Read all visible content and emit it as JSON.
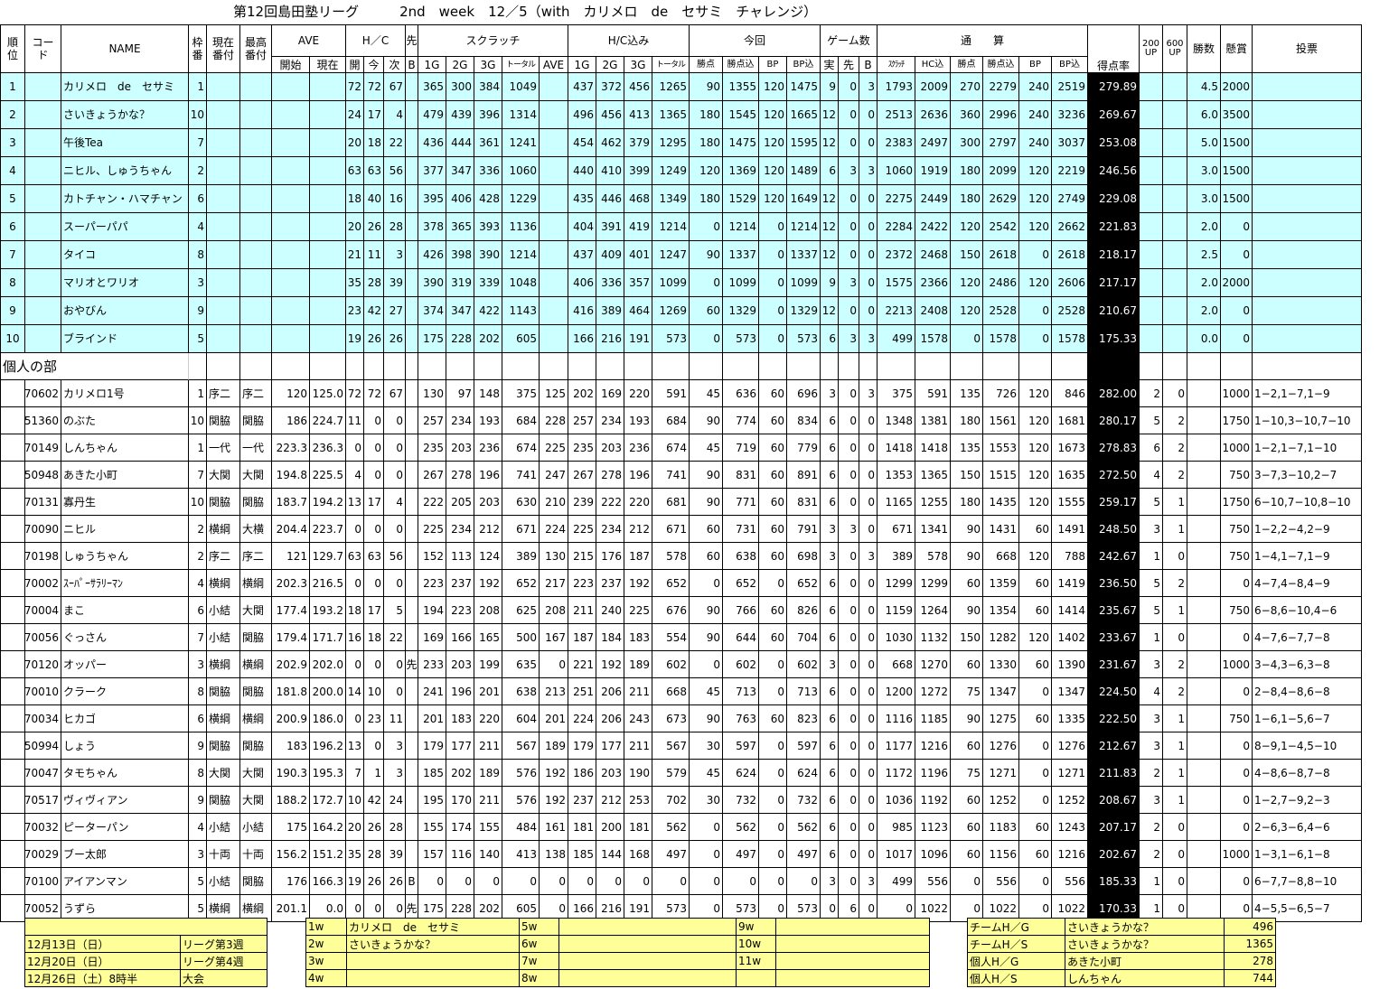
{
  "title": "第12回島田塾リーグ　　　2nd　week　12／5（with　カリメロ　de　セサミ　チャレンジ）",
  "headers": {
    "rank": "順位",
    "code": "コード",
    "name": "NAME",
    "waku": "枠番",
    "genzai": "現在番付",
    "saiko": "最高番付",
    "ave": "AVE",
    "hc": "H／C",
    "saki": "先",
    "scratch": "スクラッチ",
    "hcin": "H/C込み",
    "konkai": "今回",
    "games": "ゲーム数",
    "tsusan": "通　　算",
    "tokutenritsu": "得点率",
    "up200": "200 UP",
    "up600": "600 UP",
    "shosu": "勝数",
    "kensho": "懸賞",
    "tohyo": "投票",
    "kaishi": "開始",
    "genzai2": "現在",
    "kai": "開",
    "kon": "今",
    "ji": "次",
    "b": "B",
    "g1": "1G",
    "g2": "2G",
    "g3": "3G",
    "total": "トータル",
    "ave2": "AVE",
    "h1": "1G",
    "h2": "2G",
    "h3": "3G",
    "htotal": "トータル",
    "k_shoten": "勝点",
    "k_shoten_in": "勝点込",
    "k_bp": "BP",
    "k_bp_in": "BP込",
    "g_jitsu": "実",
    "g_saki": "先",
    "g_b": "B",
    "t_scratch": "ｽｸﾗｯﾁ",
    "t_hc": "HC込",
    "t_shoten": "勝点",
    "t_shoten_in": "勝点込",
    "t_bp": "BP",
    "t_bp_in": "BP込"
  },
  "section_individual": "個人の部",
  "teams": [
    [
      "1",
      "",
      "カリメロ　de　セサミ",
      "1",
      "",
      "",
      "",
      "",
      "72",
      "72",
      "67",
      "",
      "365",
      "300",
      "384",
      "1049",
      "",
      "437",
      "372",
      "456",
      "1265",
      "90",
      "1355",
      "120",
      "1475",
      "9",
      "0",
      "3",
      "1793",
      "2009",
      "270",
      "2279",
      "240",
      "2519",
      "279.89",
      "",
      "",
      "4.5",
      "2000",
      ""
    ],
    [
      "2",
      "",
      "さいきょうかな？",
      "10",
      "",
      "",
      "",
      "",
      "24",
      "17",
      "4",
      "",
      "479",
      "439",
      "396",
      "1314",
      "",
      "496",
      "456",
      "413",
      "1365",
      "180",
      "1545",
      "120",
      "1665",
      "12",
      "0",
      "0",
      "2513",
      "2636",
      "360",
      "2996",
      "240",
      "3236",
      "269.67",
      "",
      "",
      "6.0",
      "3500",
      ""
    ],
    [
      "3",
      "",
      "午後Tea",
      "7",
      "",
      "",
      "",
      "",
      "20",
      "18",
      "22",
      "",
      "436",
      "444",
      "361",
      "1241",
      "",
      "454",
      "462",
      "379",
      "1295",
      "180",
      "1475",
      "120",
      "1595",
      "12",
      "0",
      "0",
      "2383",
      "2497",
      "300",
      "2797",
      "240",
      "3037",
      "253.08",
      "",
      "",
      "5.0",
      "1500",
      ""
    ],
    [
      "4",
      "",
      "ニヒル、しゅうちゃん",
      "2",
      "",
      "",
      "",
      "",
      "63",
      "63",
      "56",
      "",
      "377",
      "347",
      "336",
      "1060",
      "",
      "440",
      "410",
      "399",
      "1249",
      "120",
      "1369",
      "120",
      "1489",
      "6",
      "3",
      "3",
      "1060",
      "1919",
      "180",
      "2099",
      "120",
      "2219",
      "246.56",
      "",
      "",
      "3.0",
      "1500",
      ""
    ],
    [
      "5",
      "",
      "カトチャン・ハマチャン",
      "6",
      "",
      "",
      "",
      "",
      "18",
      "40",
      "16",
      "",
      "395",
      "406",
      "428",
      "1229",
      "",
      "435",
      "446",
      "468",
      "1349",
      "180",
      "1529",
      "120",
      "1649",
      "12",
      "0",
      "0",
      "2275",
      "2449",
      "180",
      "2629",
      "120",
      "2749",
      "229.08",
      "",
      "",
      "3.0",
      "1500",
      ""
    ],
    [
      "6",
      "",
      "スーパーパパ",
      "4",
      "",
      "",
      "",
      "",
      "20",
      "26",
      "28",
      "",
      "378",
      "365",
      "393",
      "1136",
      "",
      "404",
      "391",
      "419",
      "1214",
      "0",
      "1214",
      "0",
      "1214",
      "12",
      "0",
      "0",
      "2284",
      "2422",
      "120",
      "2542",
      "120",
      "2662",
      "221.83",
      "",
      "",
      "2.0",
      "0",
      ""
    ],
    [
      "7",
      "",
      "タイコ",
      "8",
      "",
      "",
      "",
      "",
      "21",
      "11",
      "3",
      "",
      "426",
      "398",
      "390",
      "1214",
      "",
      "437",
      "409",
      "401",
      "1247",
      "90",
      "1337",
      "0",
      "1337",
      "12",
      "0",
      "0",
      "2372",
      "2468",
      "150",
      "2618",
      "0",
      "2618",
      "218.17",
      "",
      "",
      "2.5",
      "0",
      ""
    ],
    [
      "8",
      "",
      "マリオとワリオ",
      "3",
      "",
      "",
      "",
      "",
      "35",
      "28",
      "39",
      "",
      "390",
      "319",
      "339",
      "1048",
      "",
      "406",
      "336",
      "357",
      "1099",
      "0",
      "1099",
      "0",
      "1099",
      "9",
      "3",
      "0",
      "1575",
      "2366",
      "120",
      "2486",
      "120",
      "2606",
      "217.17",
      "",
      "",
      "2.0",
      "2000",
      ""
    ],
    [
      "9",
      "",
      "おやびん",
      "9",
      "",
      "",
      "",
      "",
      "23",
      "42",
      "27",
      "",
      "374",
      "347",
      "422",
      "1143",
      "",
      "416",
      "389",
      "464",
      "1269",
      "60",
      "1329",
      "0",
      "1329",
      "12",
      "0",
      "0",
      "2213",
      "2408",
      "120",
      "2528",
      "0",
      "2528",
      "210.67",
      "",
      "",
      "2.0",
      "0",
      ""
    ],
    [
      "10",
      "",
      "ブラインド",
      "5",
      "",
      "",
      "",
      "",
      "19",
      "26",
      "26",
      "",
      "175",
      "228",
      "202",
      "605",
      "",
      "166",
      "216",
      "191",
      "573",
      "0",
      "573",
      "0",
      "573",
      "6",
      "3",
      "3",
      "499",
      "1578",
      "0",
      "1578",
      "0",
      "1578",
      "175.33",
      "",
      "",
      "0.0",
      "0",
      ""
    ]
  ],
  "players": [
    [
      "",
      "70602",
      "カリメロ1号",
      "1",
      "序二",
      "序二",
      "120",
      "125.0",
      "72",
      "72",
      "67",
      "",
      "130",
      "97",
      "148",
      "375",
      "125",
      "202",
      "169",
      "220",
      "591",
      "45",
      "636",
      "60",
      "696",
      "3",
      "0",
      "3",
      "375",
      "591",
      "135",
      "726",
      "120",
      "846",
      "282.00",
      "2",
      "0",
      "",
      "1000",
      "1−2,1−7,1−9"
    ],
    [
      "",
      "51360",
      "のぶた",
      "10",
      "関脇",
      "関脇",
      "186",
      "224.7",
      "11",
      "0",
      "0",
      "",
      "257",
      "234",
      "193",
      "684",
      "228",
      "257",
      "234",
      "193",
      "684",
      "90",
      "774",
      "60",
      "834",
      "6",
      "0",
      "0",
      "1348",
      "1381",
      "180",
      "1561",
      "120",
      "1681",
      "280.17",
      "5",
      "2",
      "",
      "1750",
      "1−10,3−10,7−10"
    ],
    [
      "",
      "70149",
      "しんちゃん",
      "1",
      "一代",
      "一代",
      "223.3",
      "236.3",
      "0",
      "0",
      "0",
      "",
      "235",
      "203",
      "236",
      "674",
      "225",
      "235",
      "203",
      "236",
      "674",
      "45",
      "719",
      "60",
      "779",
      "6",
      "0",
      "0",
      "1418",
      "1418",
      "135",
      "1553",
      "120",
      "1673",
      "278.83",
      "6",
      "2",
      "",
      "1000",
      "1−2,1−7,1−10"
    ],
    [
      "",
      "50948",
      "あきた小町",
      "7",
      "大関",
      "大関",
      "194.8",
      "225.5",
      "4",
      "0",
      "0",
      "",
      "267",
      "278",
      "196",
      "741",
      "247",
      "267",
      "278",
      "196",
      "741",
      "90",
      "831",
      "60",
      "891",
      "6",
      "0",
      "0",
      "1353",
      "1365",
      "150",
      "1515",
      "120",
      "1635",
      "272.50",
      "4",
      "2",
      "",
      "750",
      "3−7,3−10,2−7"
    ],
    [
      "",
      "70131",
      "寡丹生",
      "10",
      "関脇",
      "関脇",
      "183.7",
      "194.2",
      "13",
      "17",
      "4",
      "",
      "222",
      "205",
      "203",
      "630",
      "210",
      "239",
      "222",
      "220",
      "681",
      "90",
      "771",
      "60",
      "831",
      "6",
      "0",
      "0",
      "1165",
      "1255",
      "180",
      "1435",
      "120",
      "1555",
      "259.17",
      "5",
      "1",
      "",
      "1750",
      "6−10,7−10,8−10"
    ],
    [
      "",
      "70090",
      "ニヒル",
      "2",
      "横綱",
      "大横",
      "204.4",
      "223.7",
      "0",
      "0",
      "0",
      "",
      "225",
      "234",
      "212",
      "671",
      "224",
      "225",
      "234",
      "212",
      "671",
      "60",
      "731",
      "60",
      "791",
      "3",
      "3",
      "0",
      "671",
      "1341",
      "90",
      "1431",
      "60",
      "1491",
      "248.50",
      "3",
      "1",
      "",
      "750",
      "1−2,2−4,2−9"
    ],
    [
      "",
      "70198",
      "しゅうちゃん",
      "2",
      "序二",
      "序二",
      "121",
      "129.7",
      "63",
      "63",
      "56",
      "",
      "152",
      "113",
      "124",
      "389",
      "130",
      "215",
      "176",
      "187",
      "578",
      "60",
      "638",
      "60",
      "698",
      "3",
      "0",
      "3",
      "389",
      "578",
      "90",
      "668",
      "120",
      "788",
      "242.67",
      "1",
      "0",
      "",
      "750",
      "1−4,1−7,1−9"
    ],
    [
      "",
      "70002",
      "ｽｰﾊﾟｰｻﾗﾘｰﾏﾝ",
      "4",
      "横綱",
      "横綱",
      "202.3",
      "216.5",
      "0",
      "0",
      "0",
      "",
      "223",
      "237",
      "192",
      "652",
      "217",
      "223",
      "237",
      "192",
      "652",
      "0",
      "652",
      "0",
      "652",
      "6",
      "0",
      "0",
      "1299",
      "1299",
      "60",
      "1359",
      "60",
      "1419",
      "236.50",
      "5",
      "2",
      "",
      "0",
      "4−7,4−8,4−9"
    ],
    [
      "",
      "70004",
      "まこ",
      "6",
      "小結",
      "大関",
      "177.4",
      "193.2",
      "18",
      "17",
      "5",
      "",
      "194",
      "223",
      "208",
      "625",
      "208",
      "211",
      "240",
      "225",
      "676",
      "90",
      "766",
      "60",
      "826",
      "6",
      "0",
      "0",
      "1159",
      "1264",
      "90",
      "1354",
      "60",
      "1414",
      "235.67",
      "5",
      "1",
      "",
      "750",
      "6−8,6−10,4−6"
    ],
    [
      "",
      "70056",
      "ぐっさん",
      "7",
      "小結",
      "関脇",
      "179.4",
      "171.7",
      "16",
      "18",
      "22",
      "",
      "169",
      "166",
      "165",
      "500",
      "167",
      "187",
      "184",
      "183",
      "554",
      "90",
      "644",
      "60",
      "704",
      "6",
      "0",
      "0",
      "1030",
      "1132",
      "150",
      "1282",
      "120",
      "1402",
      "233.67",
      "1",
      "0",
      "",
      "0",
      "4−7,6−7,7−8"
    ],
    [
      "",
      "70120",
      "オッパー",
      "3",
      "横綱",
      "横綱",
      "202.9",
      "202.0",
      "0",
      "0",
      "0",
      "先",
      "233",
      "203",
      "199",
      "635",
      "0",
      "221",
      "192",
      "189",
      "602",
      "0",
      "602",
      "0",
      "602",
      "3",
      "0",
      "0",
      "668",
      "1270",
      "60",
      "1330",
      "60",
      "1390",
      "231.67",
      "3",
      "2",
      "",
      "1000",
      "3−4,3−6,3−8"
    ],
    [
      "",
      "70010",
      "クラーク",
      "8",
      "関脇",
      "関脇",
      "181.8",
      "200.0",
      "14",
      "10",
      "0",
      "",
      "241",
      "196",
      "201",
      "638",
      "213",
      "251",
      "206",
      "211",
      "668",
      "45",
      "713",
      "0",
      "713",
      "6",
      "0",
      "0",
      "1200",
      "1272",
      "75",
      "1347",
      "0",
      "1347",
      "224.50",
      "4",
      "2",
      "",
      "0",
      "2−8,4−8,6−8"
    ],
    [
      "",
      "70034",
      "ヒカゴ",
      "6",
      "横綱",
      "横綱",
      "200.9",
      "186.0",
      "0",
      "23",
      "11",
      "",
      "201",
      "183",
      "220",
      "604",
      "201",
      "224",
      "206",
      "243",
      "673",
      "90",
      "763",
      "60",
      "823",
      "6",
      "0",
      "0",
      "1116",
      "1185",
      "90",
      "1275",
      "60",
      "1335",
      "222.50",
      "3",
      "1",
      "",
      "750",
      "1−6,1−5,6−7"
    ],
    [
      "",
      "50994",
      "しょう",
      "9",
      "関脇",
      "関脇",
      "183",
      "196.2",
      "13",
      "0",
      "3",
      "",
      "179",
      "177",
      "211",
      "567",
      "189",
      "179",
      "177",
      "211",
      "567",
      "30",
      "597",
      "0",
      "597",
      "6",
      "0",
      "0",
      "1177",
      "1216",
      "60",
      "1276",
      "0",
      "1276",
      "212.67",
      "3",
      "1",
      "",
      "0",
      "8−9,1−4,5−10"
    ],
    [
      "",
      "70047",
      "タモちゃん",
      "8",
      "大関",
      "大関",
      "190.3",
      "195.3",
      "7",
      "1",
      "3",
      "",
      "185",
      "202",
      "189",
      "576",
      "192",
      "186",
      "203",
      "190",
      "579",
      "45",
      "624",
      "0",
      "624",
      "6",
      "0",
      "0",
      "1172",
      "1196",
      "75",
      "1271",
      "0",
      "1271",
      "211.83",
      "2",
      "1",
      "",
      "0",
      "4−8,6−8,7−8"
    ],
    [
      "",
      "70517",
      "ヴィヴィアン",
      "9",
      "関脇",
      "大関",
      "188.2",
      "172.7",
      "10",
      "42",
      "24",
      "",
      "195",
      "170",
      "211",
      "576",
      "192",
      "237",
      "212",
      "253",
      "702",
      "30",
      "732",
      "0",
      "732",
      "6",
      "0",
      "0",
      "1036",
      "1192",
      "60",
      "1252",
      "0",
      "1252",
      "208.67",
      "3",
      "1",
      "",
      "0",
      "1−2,7−9,2−3"
    ],
    [
      "",
      "70032",
      "ピーターパン",
      "4",
      "小結",
      "小結",
      "175",
      "164.2",
      "20",
      "26",
      "28",
      "",
      "155",
      "174",
      "155",
      "484",
      "161",
      "181",
      "200",
      "181",
      "562",
      "0",
      "562",
      "0",
      "562",
      "6",
      "0",
      "0",
      "985",
      "1123",
      "60",
      "1183",
      "60",
      "1243",
      "207.17",
      "2",
      "0",
      "",
      "0",
      "2−6,3−6,4−6"
    ],
    [
      "",
      "70029",
      "ブー太郎",
      "3",
      "十両",
      "十両",
      "156.2",
      "151.2",
      "35",
      "28",
      "39",
      "",
      "157",
      "116",
      "140",
      "413",
      "138",
      "185",
      "144",
      "168",
      "497",
      "0",
      "497",
      "0",
      "497",
      "6",
      "0",
      "0",
      "1017",
      "1096",
      "60",
      "1156",
      "60",
      "1216",
      "202.67",
      "2",
      "0",
      "",
      "1000",
      "1−3,1−6,1−8"
    ],
    [
      "",
      "70100",
      "アイアンマン",
      "5",
      "小結",
      "関脇",
      "176",
      "166.3",
      "19",
      "26",
      "26",
      "B",
      "0",
      "0",
      "0",
      "0",
      "0",
      "0",
      "0",
      "0",
      "0",
      "0",
      "0",
      "0",
      "0",
      "3",
      "0",
      "3",
      "499",
      "556",
      "0",
      "556",
      "0",
      "556",
      "185.33",
      "1",
      "0",
      "",
      "0",
      "6−7,7−8,8−10"
    ],
    [
      "",
      "70052",
      "うずら",
      "5",
      "横綱",
      "横綱",
      "201.1",
      "0.0",
      "0",
      "0",
      "0",
      "先",
      "175",
      "228",
      "202",
      "605",
      "0",
      "166",
      "216",
      "191",
      "573",
      "0",
      "573",
      "0",
      "573",
      "0",
      "6",
      "0",
      "0",
      "1022",
      "0",
      "1022",
      "0",
      "1022",
      "170.33",
      "1",
      "0",
      "",
      "0",
      "4−5,5−6,5−7"
    ]
  ],
  "schedule": [
    {
      "date": "12月13日（日）",
      "event": "リーグ第3週"
    },
    {
      "date": "12月20日（日）",
      "event": "リーグ第4週"
    },
    {
      "date": "12月26日（土）8時半",
      "event": "大会"
    }
  ],
  "weeks": [
    {
      "w": "1w",
      "v": "カリメロ　de　セサミ"
    },
    {
      "w": "5w",
      "v": ""
    },
    {
      "w": "9w",
      "v": ""
    },
    {
      "w": "2w",
      "v": "さいきょうかな？"
    },
    {
      "w": "6w",
      "v": ""
    },
    {
      "w": "10w",
      "v": ""
    },
    {
      "w": "3w",
      "v": ""
    },
    {
      "w": "7w",
      "v": ""
    },
    {
      "w": "11w",
      "v": ""
    },
    {
      "w": "4w",
      "v": ""
    },
    {
      "w": "8w",
      "v": ""
    },
    {
      "w": "",
      "v": ""
    }
  ],
  "highs": [
    {
      "label": "チームH／G",
      "name": "さいきょうかな？",
      "value": "496"
    },
    {
      "label": "チームH／S",
      "name": "さいきょうかな？",
      "value": "1365"
    },
    {
      "label": "個人H／G",
      "name": "あきた小町",
      "value": "278"
    },
    {
      "label": "個人H／S",
      "name": "しんちゃん",
      "value": "744"
    }
  ]
}
